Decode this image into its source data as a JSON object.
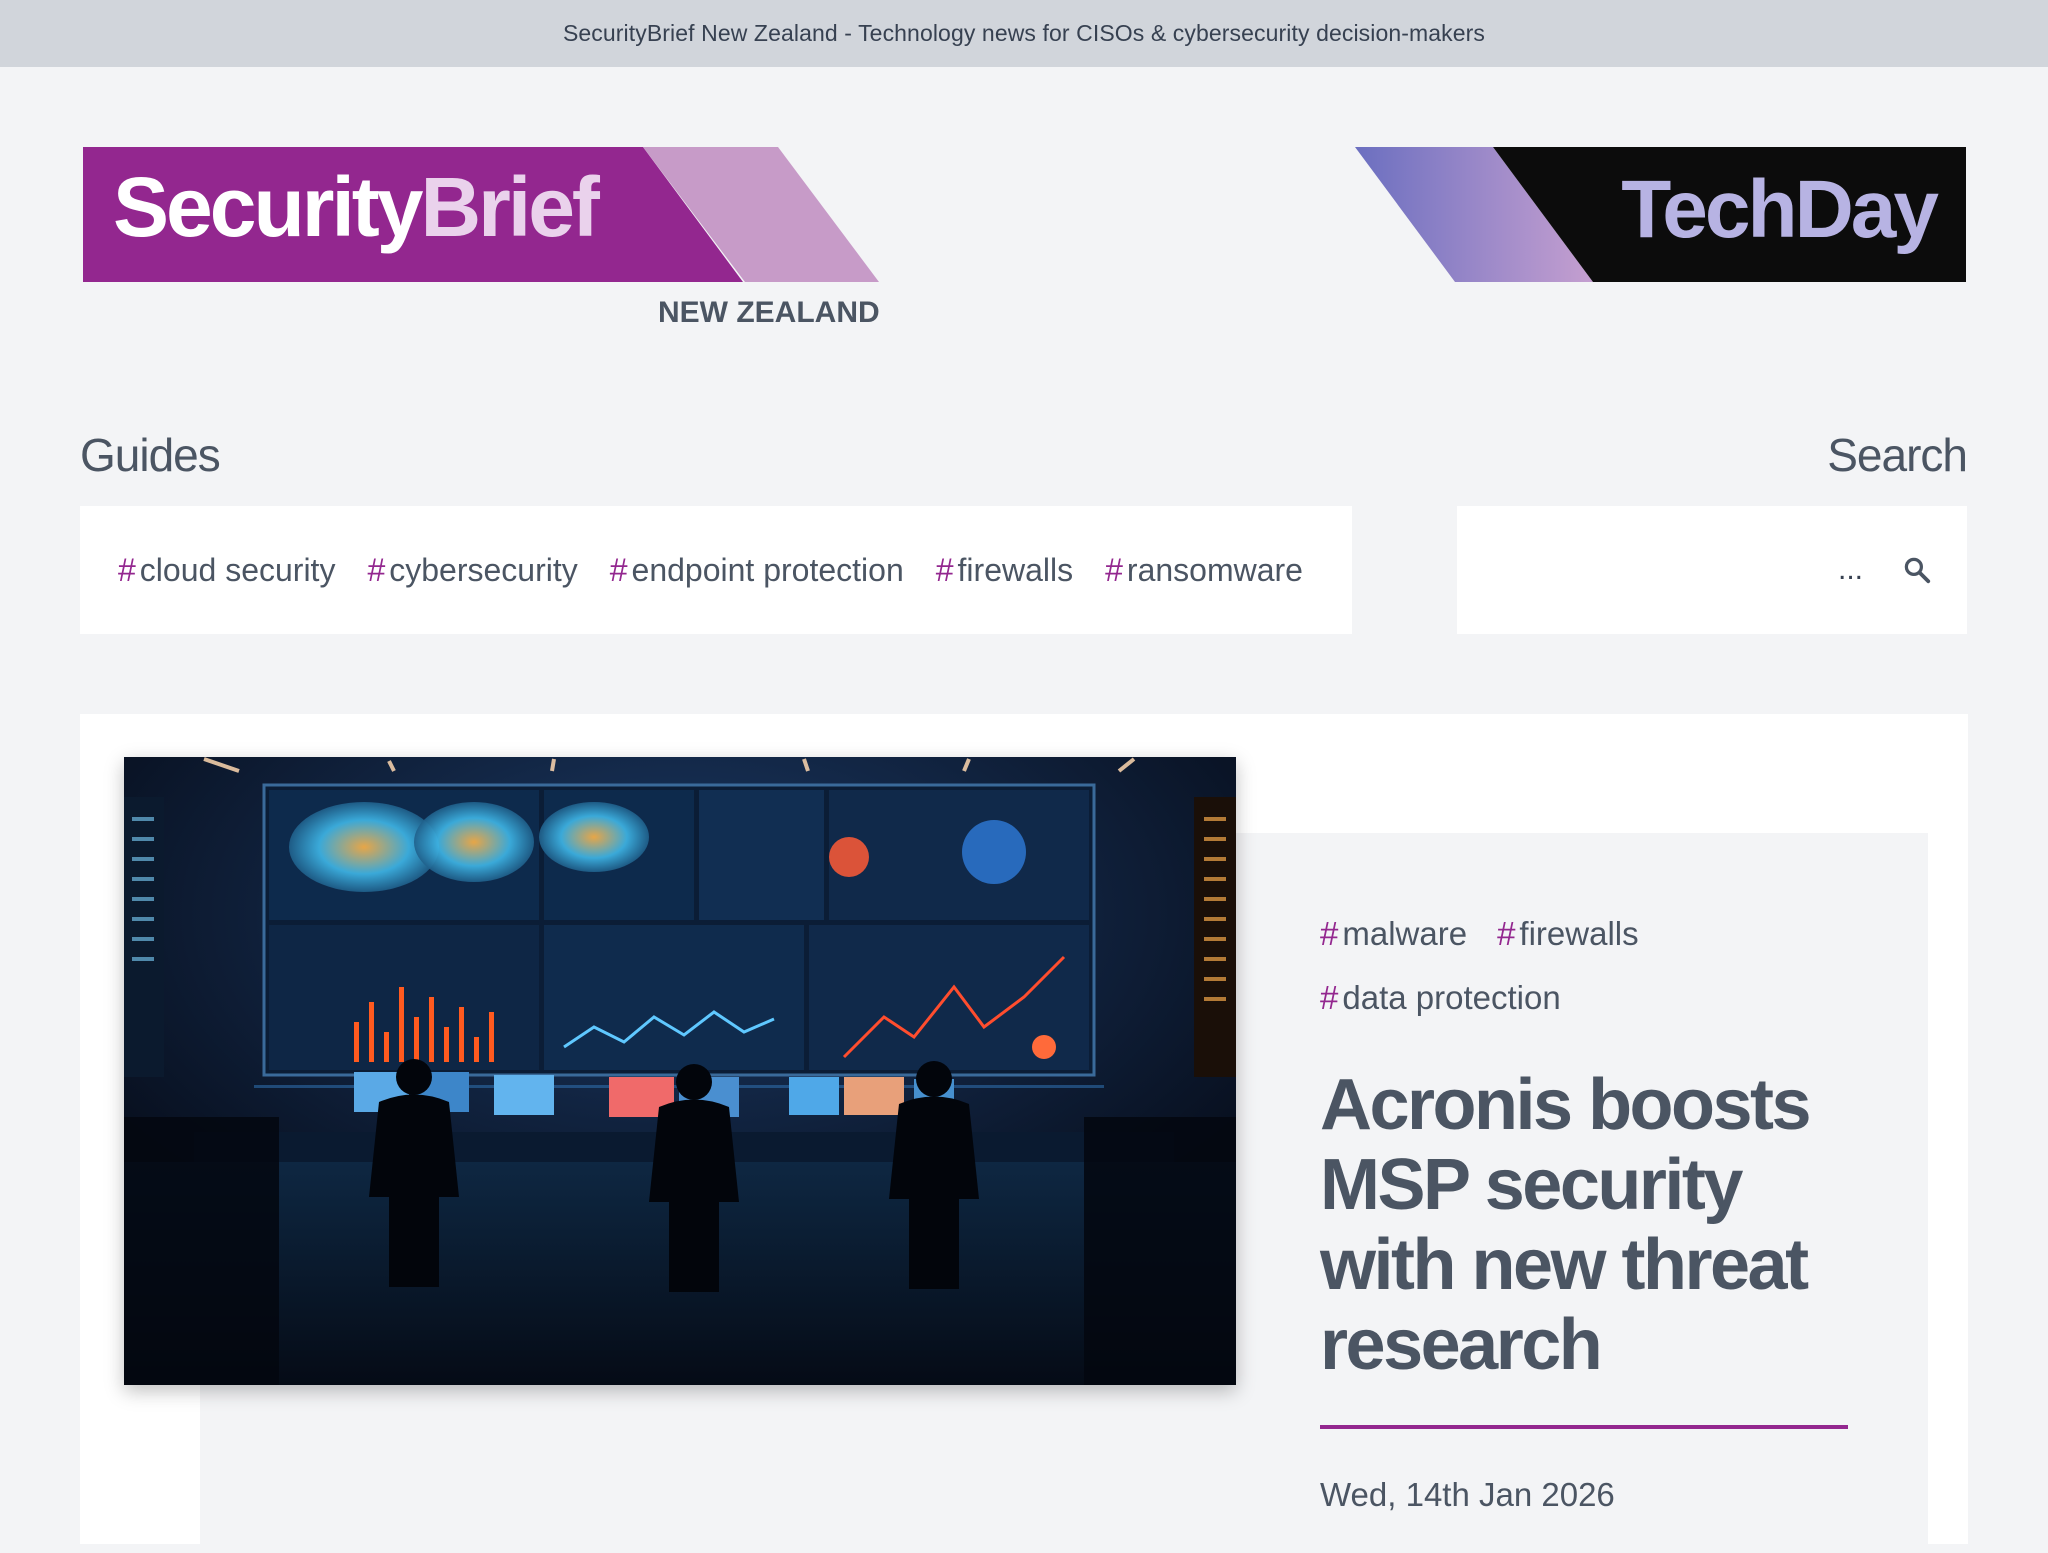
{
  "topbar": {
    "text": "SecurityBrief New Zealand - Technology news for CISOs & cybersecurity decision-makers"
  },
  "logo_securitybrief": {
    "word1": "Security",
    "word2": "Brief",
    "region": "NEW ZEALAND",
    "colors": {
      "primary": "#93278f",
      "secondary": "#c79bc8"
    }
  },
  "logo_techday": {
    "text": "TechDay",
    "colors": {
      "background": "#0a0a0a",
      "gradient": [
        "#6b6fc0",
        "#c59fd0"
      ]
    }
  },
  "guides": {
    "heading": "Guides",
    "tags": [
      "cloud security",
      "cybersecurity",
      "endpoint protection",
      "firewalls",
      "ransomware"
    ]
  },
  "search": {
    "heading": "Search",
    "placeholder": "...",
    "icon": "search-icon"
  },
  "article": {
    "tags": [
      "malware",
      "firewalls",
      "data protection"
    ],
    "headline": "Acronis boosts MSP security with new threat research",
    "date": "Wed, 14th Jan 2026",
    "image_icon": "security-operations-center-image"
  },
  "tag_prefix": "#",
  "colors": {
    "accent": "#93278f",
    "text": "#4b5563",
    "page_bg": "#f3f4f6",
    "topbar_bg": "#d1d5db"
  }
}
